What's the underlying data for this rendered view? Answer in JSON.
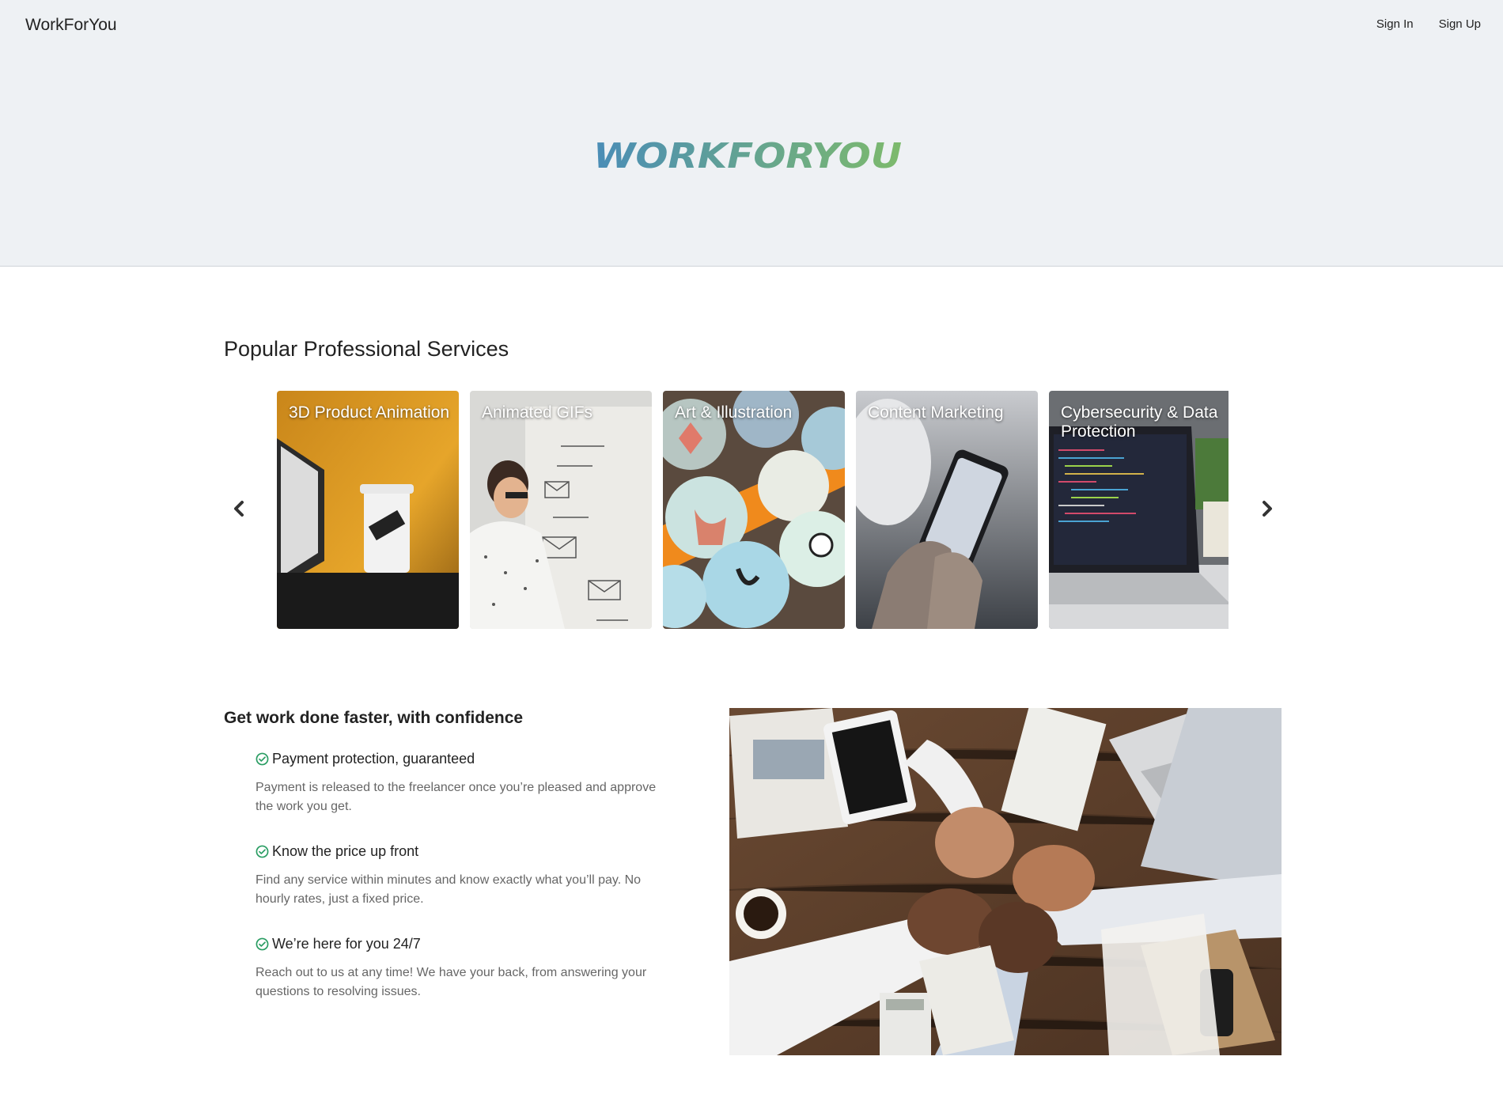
{
  "header": {
    "brand": "WorkForYou",
    "nav": {
      "sign_in": "Sign In",
      "sign_up": "Sign Up"
    },
    "logo_text": "WORKFORYOU"
  },
  "services": {
    "title": "Popular Professional Services",
    "cards": [
      {
        "label": "3D Product Animation"
      },
      {
        "label": "Animated GIFs"
      },
      {
        "label": "Art & Illustration"
      },
      {
        "label": "Content Marketing"
      },
      {
        "label": "Cybersecurity & Data Protection"
      }
    ]
  },
  "confidence": {
    "title": "Get work done faster, with confidence",
    "features": [
      {
        "title": "Payment protection, guaranteed",
        "desc": "Payment is released to the freelancer once you’re pleased and approve the work you get."
      },
      {
        "title": "Know the price up front",
        "desc": "Find any service within minutes and know exactly what you’ll pay. No hourly rates, just a fixed price."
      },
      {
        "title": "We’re here for you 24/7",
        "desc": "Reach out to us at any time! We have your back, from answering your questions to resolving issues."
      }
    ]
  },
  "colors": {
    "hero_bg": "#eef1f4",
    "logo_blue": "#4a8db7",
    "logo_green": "#7dba6c",
    "check_green": "#2a9d63"
  },
  "icons": {
    "prev": "chevron-left-icon",
    "next": "chevron-right-icon",
    "check": "check-circle-icon"
  }
}
